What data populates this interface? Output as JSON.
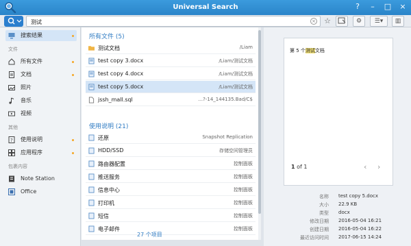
{
  "window": {
    "title": "Universal Search"
  },
  "toolbar": {
    "search_value": "测试"
  },
  "sidebar": {
    "search_results": "搜索结果",
    "section_files": "文件",
    "files": [
      {
        "label": "所有文件",
        "dot": true
      },
      {
        "label": "文档",
        "dot": true
      },
      {
        "label": "照片",
        "dot": false
      },
      {
        "label": "音乐",
        "dot": false
      },
      {
        "label": "视频",
        "dot": false
      }
    ],
    "section_other": "其他",
    "other": [
      {
        "label": "使用说明",
        "dot": true
      },
      {
        "label": "应用程序",
        "dot": true
      }
    ],
    "section_packages": "包裹内容",
    "packages": [
      {
        "label": "Note Station"
      },
      {
        "label": "Office"
      }
    ]
  },
  "results": {
    "files_title": "所有文件 (5)",
    "files": [
      {
        "name": "测试文档",
        "path": "/Liam",
        "icon": "folder-icon"
      },
      {
        "name": "test copy 3.docx",
        "path": "/Liam/测试文档",
        "icon": "document-icon"
      },
      {
        "name": "test copy 4.docx",
        "path": "/Liam/测试文档",
        "icon": "document-icon"
      },
      {
        "name": "test copy 5.docx",
        "path": "/Liam/测试文档",
        "icon": "document-icon"
      },
      {
        "name": "jssh_mall.sql",
        "path": "...?-14_144135.Bad/C$",
        "icon": "file-icon"
      }
    ],
    "help_title": "使用说明 (21)",
    "help": [
      {
        "name": "还原",
        "path": "Snapshot Replication"
      },
      {
        "name": "HDD/SSD",
        "path": "存储空间管理员"
      },
      {
        "name": "路由器配置",
        "path": "控制面板"
      },
      {
        "name": "推送服务",
        "path": "控制面板"
      },
      {
        "name": "信息中心",
        "path": "控制面板"
      },
      {
        "name": "打印机",
        "path": "控制面板"
      },
      {
        "name": "短信",
        "path": "控制面板"
      },
      {
        "name": "电子邮件",
        "path": "控制面板"
      }
    ],
    "count": "27 个项目"
  },
  "preview": {
    "doc_text_pre": "第 5 个",
    "doc_text_hl": "测试",
    "doc_text_post": "文档",
    "page_current": "1",
    "page_of": "of 1"
  },
  "meta": [
    {
      "k": "名称",
      "v": "test copy 5.docx"
    },
    {
      "k": "大小",
      "v": "22.9 KB"
    },
    {
      "k": "类型",
      "v": "docx"
    },
    {
      "k": "修改日期",
      "v": "2016-05-04 16:21"
    },
    {
      "k": "创建日期",
      "v": "2016-05-04 16:22"
    },
    {
      "k": "最近访问时间",
      "v": "2017-06-15 14:24"
    }
  ],
  "colors": {
    "accent": "#2b7fce",
    "titlebar": "#2a84c9",
    "dot": "#f5a623",
    "highlight": "#f3e27a"
  }
}
